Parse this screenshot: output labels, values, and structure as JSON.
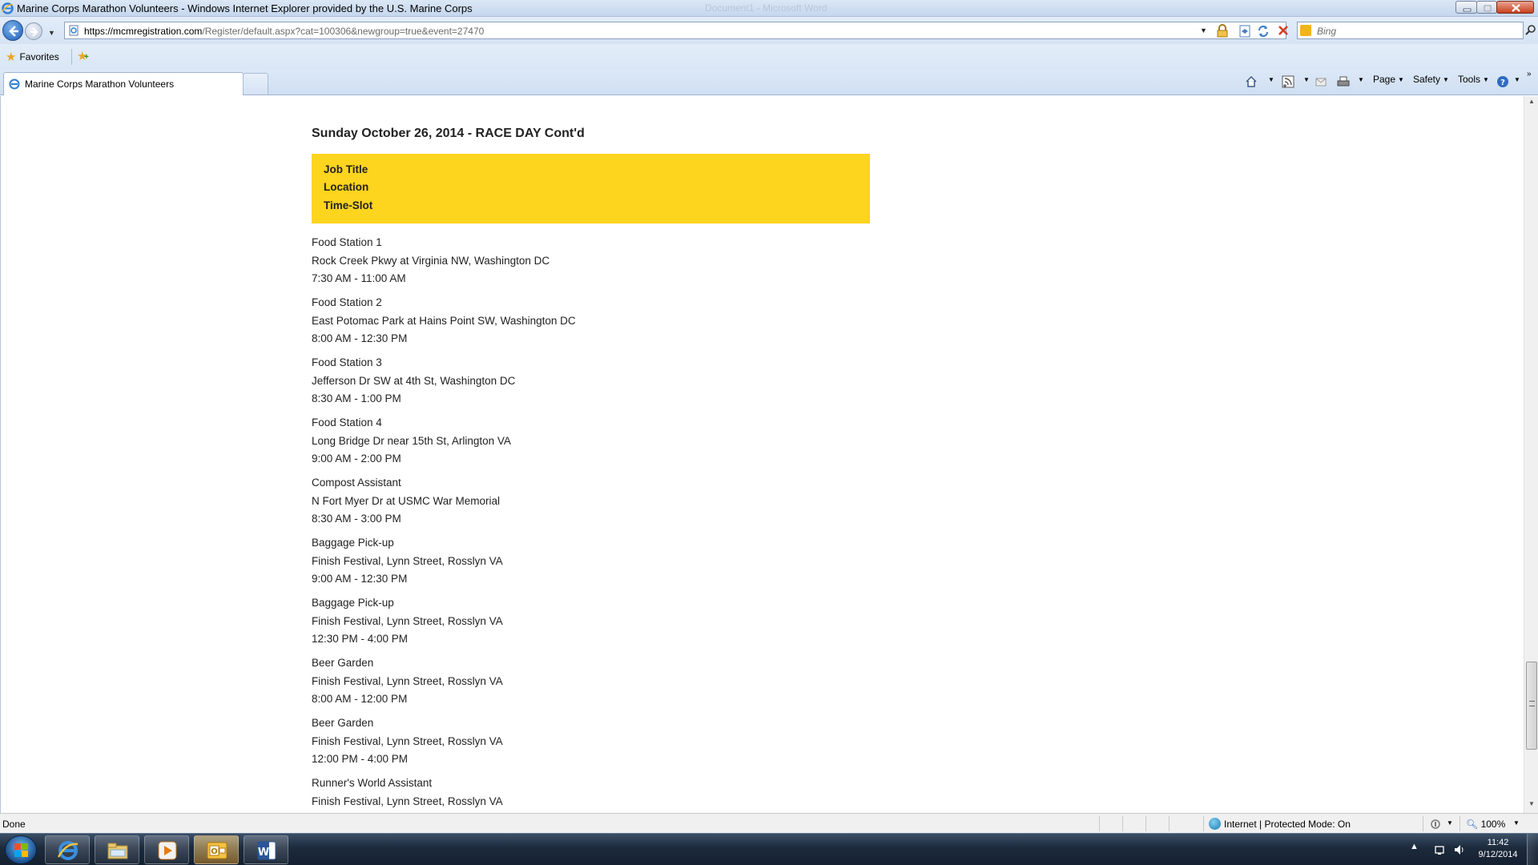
{
  "window": {
    "title": "Marine Corps Marathon Volunteers - Windows Internet Explorer provided by the U.S. Marine Corps",
    "ghost_title": "Document1 - Microsoft Word"
  },
  "address_bar": {
    "url_host": "https://mcmregistration.com",
    "url_path": "/Register/default.aspx?cat=100306&newgroup=true&event=27470"
  },
  "search": {
    "placeholder": "Bing"
  },
  "favorites_bar": {
    "favorites_label": "Favorites"
  },
  "tab": {
    "label": "Marine Corps Marathon Volunteers"
  },
  "command_bar": {
    "page_label": "Page",
    "safety_label": "Safety",
    "tools_label": "Tools"
  },
  "page": {
    "section_title": "Sunday October 26, 2014 - RACE DAY Cont'd",
    "header": {
      "job_title": "Job Title",
      "location": "Location",
      "time_slot": "Time-Slot"
    },
    "jobs": [
      {
        "title": "Food Station 1",
        "location": "Rock Creek Pkwy at Virginia NW, Washington DC",
        "time": "7:30 AM - 11:00 AM"
      },
      {
        "title": "Food Station 2",
        "location": "East Potomac Park at Hains Point SW, Washington DC",
        "time": "8:00 AM - 12:30 PM"
      },
      {
        "title": "Food Station 3",
        "location": "Jefferson Dr SW at 4th St, Washington DC",
        "time": "8:30 AM - 1:00 PM"
      },
      {
        "title": "Food Station 4",
        "location": "Long Bridge Dr near 15th St, Arlington VA",
        "time": "9:00 AM - 2:00 PM"
      },
      {
        "title": "Compost Assistant",
        "location": "N Fort Myer Dr at USMC War Memorial",
        "time": "8:30 AM - 3:00 PM"
      },
      {
        "title": "Baggage Pick-up",
        "location": "Finish Festival, Lynn Street, Rosslyn VA",
        "time": "9:00 AM - 12:30 PM"
      },
      {
        "title": "Baggage Pick-up",
        "location": "Finish Festival, Lynn Street, Rosslyn VA",
        "time": "12:30 PM - 4:00 PM"
      },
      {
        "title": "Beer Garden",
        "location": "Finish Festival, Lynn Street, Rosslyn VA",
        "time": "8:00 AM - 12:00 PM"
      },
      {
        "title": "Beer Garden",
        "location": "Finish Festival, Lynn Street, Rosslyn VA",
        "time": "12:00 PM - 4:00 PM"
      },
      {
        "title": "Runner's World Assistant",
        "location": "Finish Festival, Lynn Street, Rosslyn VA",
        "time": ""
      }
    ],
    "header_color": "#fdd41e"
  },
  "status_bar": {
    "status": "Done",
    "zone": "Internet | Protected Mode: On",
    "zoom": "100%"
  },
  "taskbar": {
    "time": "11:42",
    "date": "9/12/2014"
  }
}
